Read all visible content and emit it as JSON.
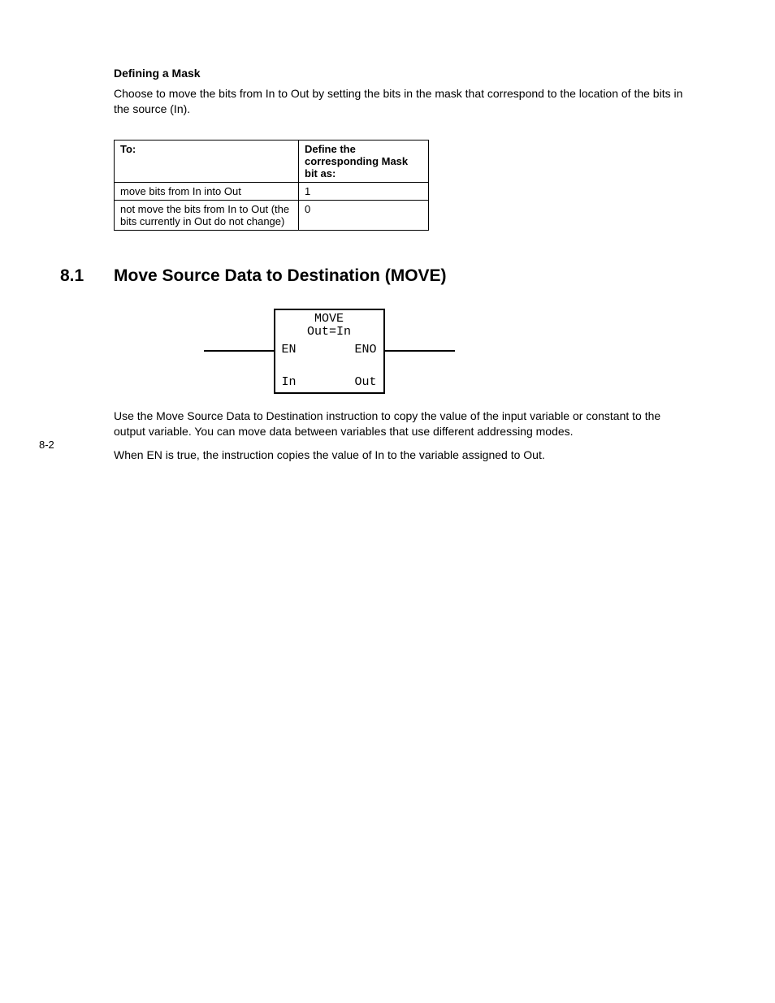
{
  "subheading": "Defining a Mask",
  "intro_para": "Choose to move the bits from In to Out by setting the bits in the mask that correspond to the location of the bits in the source (In).",
  "mask_table": {
    "headers": [
      "To:",
      "Define the corresponding Mask bit as:"
    ],
    "rows": [
      [
        "move bits from In into Out",
        "1"
      ],
      [
        "not move the bits from In to Out (the bits currently in Out do not change)",
        "0"
      ]
    ]
  },
  "section": {
    "number": "8.1",
    "title": "Move Source Data to Destination (MOVE)"
  },
  "diagram": {
    "name": "MOVE",
    "subtitle": "Out=In",
    "left_top": "EN",
    "right_top": "ENO",
    "left_bot": "In",
    "right_bot": "Out"
  },
  "body_para_1": "Use the Move Source Data to Destination instruction to copy the value of the input variable or constant to the output variable. You can move data between variables that use different addressing modes.",
  "body_para_2": "When EN is true, the instruction copies the value of In to the variable assigned to Out.",
  "page_number": "8-2"
}
